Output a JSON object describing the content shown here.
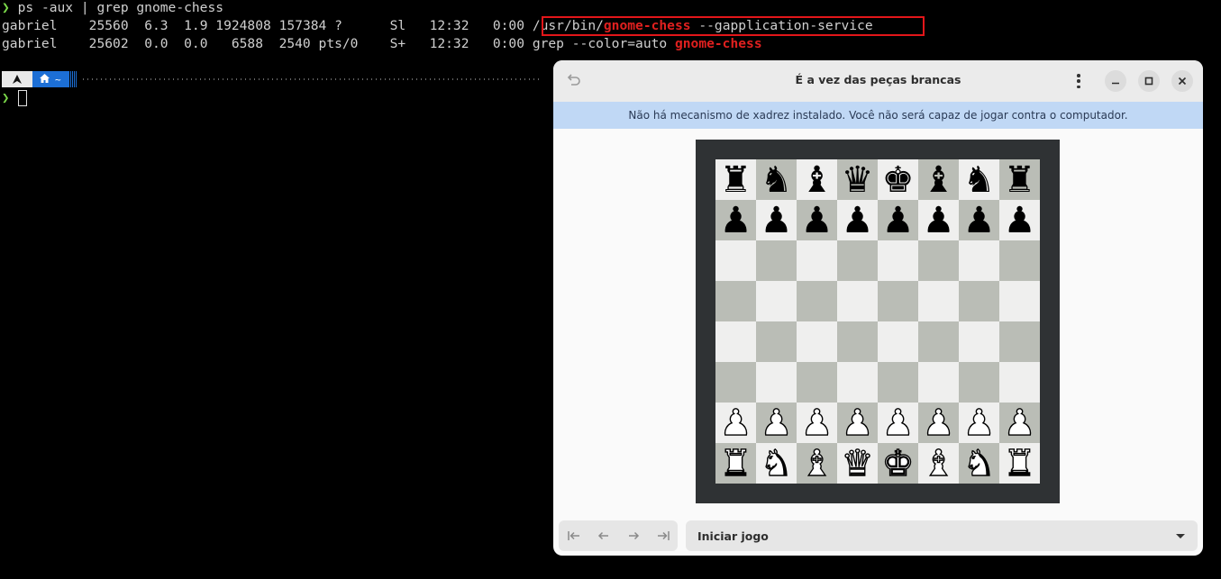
{
  "terminal": {
    "command_line": {
      "prompt": "❯",
      "command": "ps -aux | grep gnome-chess"
    },
    "rows": [
      {
        "user": "gabriel",
        "pid": "25560",
        "cpu": "6.3",
        "mem": "1.9",
        "vsz": "1924808",
        "rss": "157384",
        "tty": "?",
        "stat": "Sl",
        "start": "12:32",
        "time": "0:00",
        "cmd_prefix": "/usr/bin/",
        "cmd_match": "gnome-chess",
        "cmd_suffix": " --gapplication-service"
      },
      {
        "user": "gabriel",
        "pid": "25602",
        "cpu": "0.0",
        "mem": "0.0",
        "vsz": "6588",
        "rss": "2540",
        "tty": "pts/0",
        "stat": "S+",
        "start": "12:32",
        "time": "0:00",
        "cmd_prefix": "grep --color=auto ",
        "cmd_match": "gnome-chess",
        "cmd_suffix": ""
      }
    ],
    "statusbar": {
      "segment_icon": "arch-icon",
      "home_icon": "home-icon",
      "path": "~"
    },
    "second_prompt": "❯",
    "colors": {
      "prompt": "#7bd94a",
      "highlight": "#e0201f",
      "annotation_box": "#e3161a"
    }
  },
  "window": {
    "title": "É a vez das peças brancas",
    "infobar_text": "Não há mecanismo de xadrez instalado. Você não será capaz de jogar contra o computador.",
    "dropdown_label": "Iniciar jogo",
    "nav_icons": [
      "first-move-icon",
      "previous-move-icon",
      "next-move-icon",
      "last-move-icon"
    ],
    "board": {
      "rows": [
        [
          "♜",
          "♞",
          "♝",
          "♛",
          "♚",
          "♝",
          "♞",
          "♜"
        ],
        [
          "♟",
          "♟",
          "♟",
          "♟",
          "♟",
          "♟",
          "♟",
          "♟"
        ],
        [
          "",
          "",
          "",
          "",
          "",
          "",
          "",
          ""
        ],
        [
          "",
          "",
          "",
          "",
          "",
          "",
          "",
          ""
        ],
        [
          "",
          "",
          "",
          "",
          "",
          "",
          "",
          ""
        ],
        [
          "",
          "",
          "",
          "",
          "",
          "",
          "",
          ""
        ],
        [
          "♙",
          "♙",
          "♙",
          "♙",
          "♙",
          "♙",
          "♙",
          "♙"
        ],
        [
          "♖",
          "♘",
          "♗",
          "♕",
          "♔",
          "♗",
          "♘",
          "♖"
        ]
      ],
      "light_color": "#efefee",
      "dark_color": "#babdb6",
      "frame_color": "#2f3234"
    }
  }
}
